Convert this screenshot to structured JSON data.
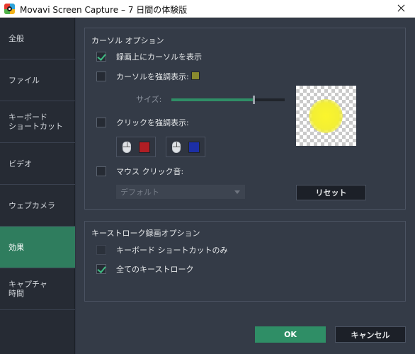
{
  "window": {
    "title": "Movavi Screen Capture – 7 日間の体験版",
    "icon": "movavi-app-icon",
    "close_icon": "close-icon"
  },
  "sidebar": {
    "items": [
      {
        "label": "全般",
        "active": false
      },
      {
        "label": "ファイル",
        "active": false
      },
      {
        "label": "キーボード\nショートカット",
        "active": false
      },
      {
        "label": "ビデオ",
        "active": false
      },
      {
        "label": "ウェブカメラ",
        "active": false
      },
      {
        "label": "効果",
        "active": true
      },
      {
        "label": "キャプチャ\n時間",
        "active": false
      }
    ]
  },
  "cursor_options": {
    "title": "カーソル オプション",
    "show_cursor": {
      "label": "録画上にカーソルを表示",
      "checked": true
    },
    "highlight_cursor": {
      "label": "カーソルを強調表示:",
      "checked": false,
      "color": "#8a8a2e"
    },
    "size": {
      "label": "サイズ:",
      "value": 0.85
    },
    "highlight_clicks": {
      "label": "クリックを強調表示:",
      "checked": false,
      "left_click_color": "#b01e24",
      "right_click_color": "#1c2fa6"
    },
    "mouse_click_sound": {
      "label": "マウス クリック音:",
      "checked": false
    },
    "sound_select": {
      "value": "デフォルト"
    },
    "preview": {
      "highlight_color": "#f6f232"
    },
    "reset_label": "リセット"
  },
  "keystroke_options": {
    "title": "キーストローク録画オプション",
    "shortcuts_only": {
      "label": "キーボード ショートカットのみ",
      "checked": false
    },
    "all_keystrokes": {
      "label": "全てのキーストローク",
      "checked": true
    }
  },
  "footer": {
    "ok_label": "OK",
    "cancel_label": "キャンセル"
  },
  "colors": {
    "accent": "#2f8e66",
    "sidebar_active": "#2f7d5e",
    "panel_bg": "#343b47",
    "sidebar_bg": "#262b34"
  }
}
